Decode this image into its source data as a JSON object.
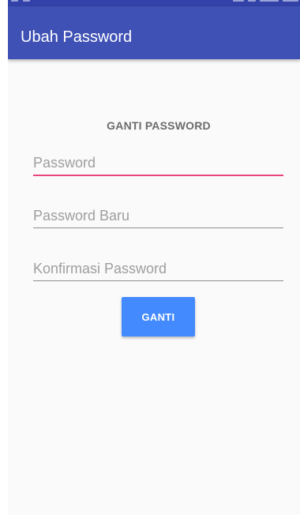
{
  "app_bar": {
    "title": "Ubah Password"
  },
  "form": {
    "heading": "GANTI PASSWORD",
    "password": {
      "placeholder": "Password",
      "value": ""
    },
    "new_password": {
      "placeholder": "Password Baru",
      "value": ""
    },
    "confirm_password": {
      "placeholder": "Konfirmasi Password",
      "value": ""
    },
    "submit_label": "GANTI"
  },
  "colors": {
    "app_bar": "#3f51b5",
    "status_bar": "#3342a8",
    "accent_focus": "#e8467c",
    "button": "#448aff",
    "background": "#fafafa"
  }
}
